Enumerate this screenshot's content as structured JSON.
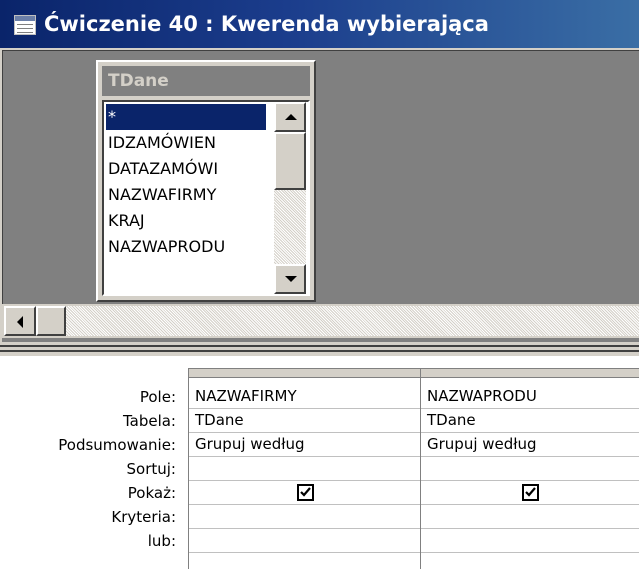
{
  "window": {
    "title": "Ćwiczenie 40 : Kwerenda wybierająca"
  },
  "field_list": {
    "table_name": "TDane",
    "items": [
      "*",
      "IDZAMÓWIEN",
      "DATAZAMÓWI",
      "NAZWAFIRMY",
      "KRAJ",
      "NAZWAPRODU"
    ],
    "selected_index": 0
  },
  "grid": {
    "row_labels": [
      "Pole:",
      "Tabela:",
      "Podsumowanie:",
      "Sortuj:",
      "Pokaż:",
      "Kryteria:",
      "lub:"
    ],
    "columns": [
      {
        "pole": "NAZWAFIRMY",
        "tabela": "TDane",
        "podsumowanie": "Grupuj według",
        "sortuj": "",
        "pokaz": true,
        "kryteria": "",
        "lub": ""
      },
      {
        "pole": "NAZWAPRODU",
        "tabela": "TDane",
        "podsumowanie": "Grupuj według",
        "sortuj": "",
        "pokaz": true,
        "kryteria": "",
        "lub": ""
      }
    ]
  },
  "colors": {
    "title_bar": "#0a246a",
    "selection": "#0a246a",
    "face": "#d4d0c8"
  }
}
